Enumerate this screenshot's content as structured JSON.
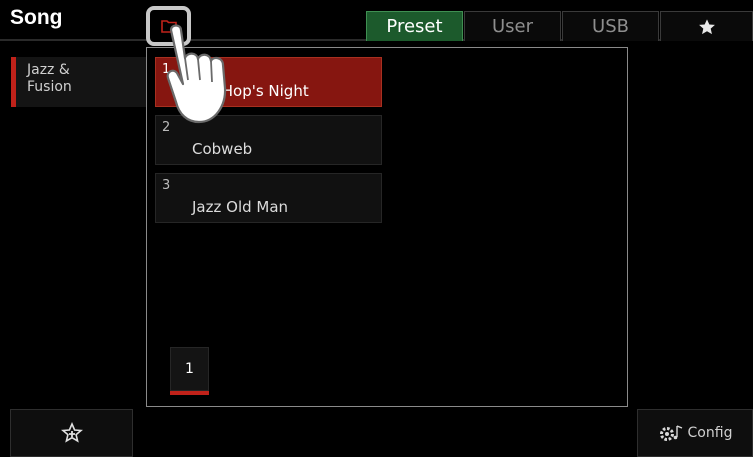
{
  "header": {
    "title": "Song",
    "folder_icon": "folder-icon",
    "tabs": [
      {
        "label": "Preset",
        "active": true
      },
      {
        "label": "User",
        "active": false
      },
      {
        "label": "USB",
        "active": false
      },
      {
        "icon": "star-icon",
        "active": false
      }
    ]
  },
  "sidebar": {
    "category": {
      "line1": "Jazz &",
      "line2": "Fusion"
    }
  },
  "songs": [
    {
      "num": "1",
      "name": "Hip Hop's Night",
      "visible_name": "...op's Night",
      "selected": true
    },
    {
      "num": "2",
      "name": "Cobweb",
      "selected": false
    },
    {
      "num": "3",
      "name": "Jazz Old Man",
      "selected": false
    }
  ],
  "pagination": {
    "current_page": "1"
  },
  "footer": {
    "favorite_add_icon": "star-plus-icon",
    "config_label": "Config",
    "config_icon": "gear-music-icon"
  },
  "colors": {
    "accent_red": "#c0221a",
    "selected_bg": "#861610",
    "tab_active_bg": "#1c5a2c"
  }
}
